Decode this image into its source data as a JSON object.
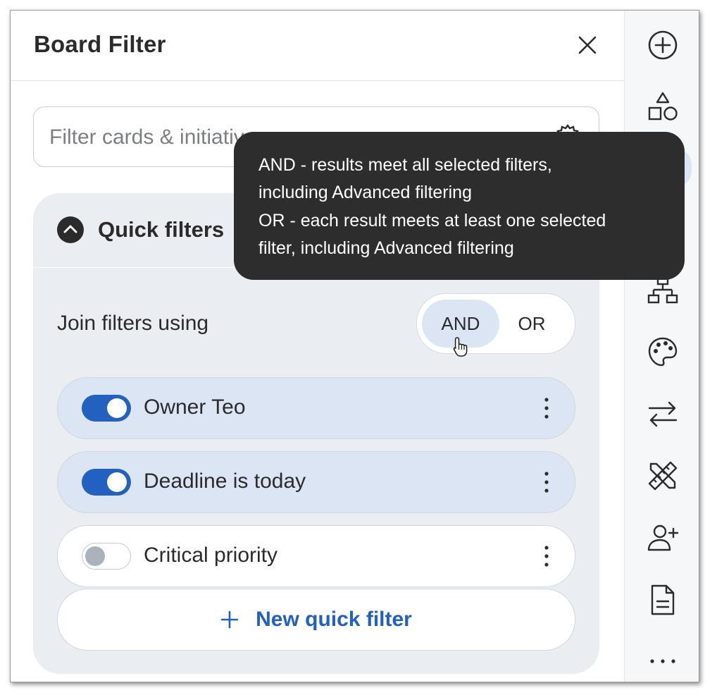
{
  "panel": {
    "title": "Board Filter",
    "search_placeholder": "Filter cards & initiatives"
  },
  "quick_filters": {
    "title": "Quick filters",
    "join_label": "Join filters using",
    "join_options": [
      "AND",
      "OR"
    ],
    "join_selected": "AND",
    "items": [
      {
        "label": "Owner Teo",
        "enabled": true
      },
      {
        "label": "Deadline is today",
        "enabled": true
      },
      {
        "label": "Critical priority",
        "enabled": false
      }
    ],
    "new_filter_label": "New quick filter"
  },
  "tooltip": {
    "lines": [
      "AND - results meet all selected filters,",
      "including Advanced filtering",
      "OR - each result meets at least one selected",
      "filter, including Advanced filtering"
    ]
  },
  "toolbar": {
    "icons": [
      "add-circle-icon",
      "shapes-icon",
      "hierarchy-icon",
      "palette-icon",
      "swap-arrows-icon",
      "ruler-pencil-icon",
      "add-user-icon",
      "document-icon",
      "more-icon"
    ]
  },
  "colors": {
    "accent": "#2261c0",
    "selected_bg": "#dce5f3",
    "tooltip_bg": "#2d2d2d",
    "card_bg": "#eaedf1"
  }
}
